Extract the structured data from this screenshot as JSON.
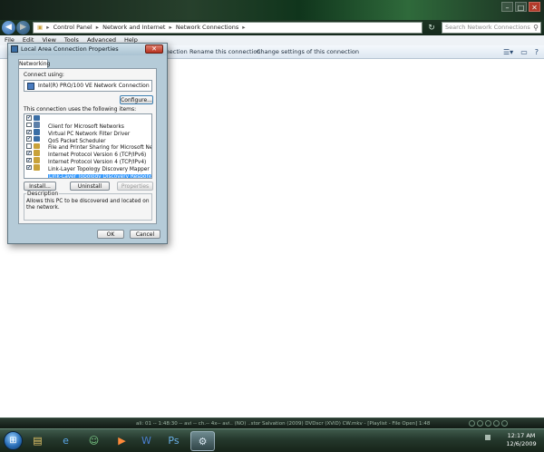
{
  "window": {
    "address_segments": [
      "Control Panel",
      "Network and Internet",
      "Network Connections"
    ],
    "search_placeholder": "Search Network Connections",
    "menu": [
      "File",
      "Edit",
      "View",
      "Tools",
      "Advanced",
      "Help"
    ],
    "commands": [
      "Connection",
      "Rename this connection",
      "Change settings of this connection"
    ],
    "caption_buttons": [
      "minimize",
      "maximize",
      "close"
    ]
  },
  "dialog": {
    "title": "Local Area Connection Properties",
    "tab": "Networking",
    "connect_using_label": "Connect using:",
    "adapter": "Intel(R) PRO/100 VE Network Connection",
    "configure_button": "Configure...",
    "items_label": "This connection uses the following items:",
    "items": [
      {
        "label": "Client for Microsoft Networks",
        "checked": true,
        "icon_color": "#3a6ea5"
      },
      {
        "label": "Virtual PC Network Filter Driver",
        "checked": false,
        "icon_color": "#5c7fa8"
      },
      {
        "label": "QoS Packet Scheduler",
        "checked": true,
        "icon_color": "#3a6ea5"
      },
      {
        "label": "File and Printer Sharing for Microsoft Networks",
        "checked": true,
        "icon_color": "#3a6ea5"
      },
      {
        "label": "Internet Protocol Version 6 (TCP/IPv6)",
        "checked": false,
        "icon_color": "#c9a23a"
      },
      {
        "label": "Internet Protocol Version 4 (TCP/IPv4)",
        "checked": true,
        "icon_color": "#c9a23a"
      },
      {
        "label": "Link-Layer Topology Discovery Mapper I/O Driver",
        "checked": true,
        "icon_color": "#c9a23a"
      },
      {
        "label": "Link-Layer Topology Discovery Responder",
        "checked": true,
        "icon_color": "#c9a23a",
        "selected": true
      }
    ],
    "install_button": "Install...",
    "uninstall_button": "Uninstall",
    "properties_button": "Properties",
    "description_label": "Description",
    "description_text": "Allows this PC to be discovered and located on the network.",
    "ok_button": "OK",
    "cancel_button": "Cancel"
  },
  "media_strip": {
    "text": "ali: 01 -- 1:48:30 -- avi -- ch.--  4x-- avi.. (NO) ..stor Salvation (2009) DVDscr (XViD) CW.mkv  - [Playlist - File Open]  1:48"
  },
  "taskbar": {
    "apps": [
      {
        "name": "file-explorer",
        "glyph": "▤",
        "color": "#e8c86a"
      },
      {
        "name": "internet-explorer",
        "glyph": "e",
        "color": "#5aa6e8"
      },
      {
        "name": "messenger",
        "glyph": "☺",
        "color": "#7fd08a"
      },
      {
        "name": "media-player",
        "glyph": "▶",
        "color": "#ff8a3a"
      },
      {
        "name": "word",
        "glyph": "W",
        "color": "#4a7fd0"
      },
      {
        "name": "photoshop",
        "glyph": "Ps",
        "color": "#6ab0e8"
      },
      {
        "name": "network-connections",
        "glyph": "⚙",
        "color": "#d8e6f0",
        "active": true
      }
    ],
    "time": "12:17 AM",
    "date": "12/6/2009"
  },
  "colors": {
    "titlebar_dark": "#131f18",
    "dialog_frame": "#b5cbd8",
    "selection": "#3399ff",
    "taskbar": "#24382c"
  }
}
